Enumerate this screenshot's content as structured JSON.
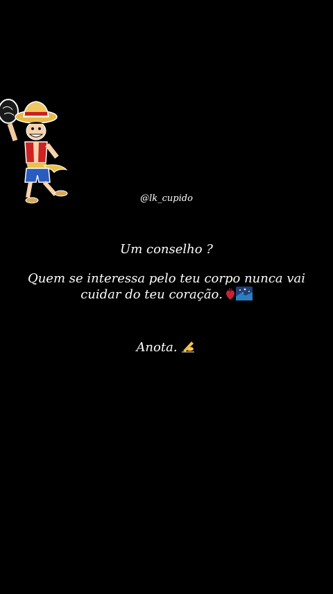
{
  "story": {
    "handle": "@lk_cupido",
    "line1": "Um conselho ?",
    "line2": "Quem se interessa pelo teu corpo nunca vai",
    "line3": "cuidar do teu coração.",
    "line4": "Anota.",
    "icons": {
      "sticker": "straw-hat-pirate-sticker",
      "emoji_a": "anatomical-heart-icon",
      "emoji_b": "night-sky-icon",
      "emoji_c": "writing-hand-icon"
    }
  }
}
